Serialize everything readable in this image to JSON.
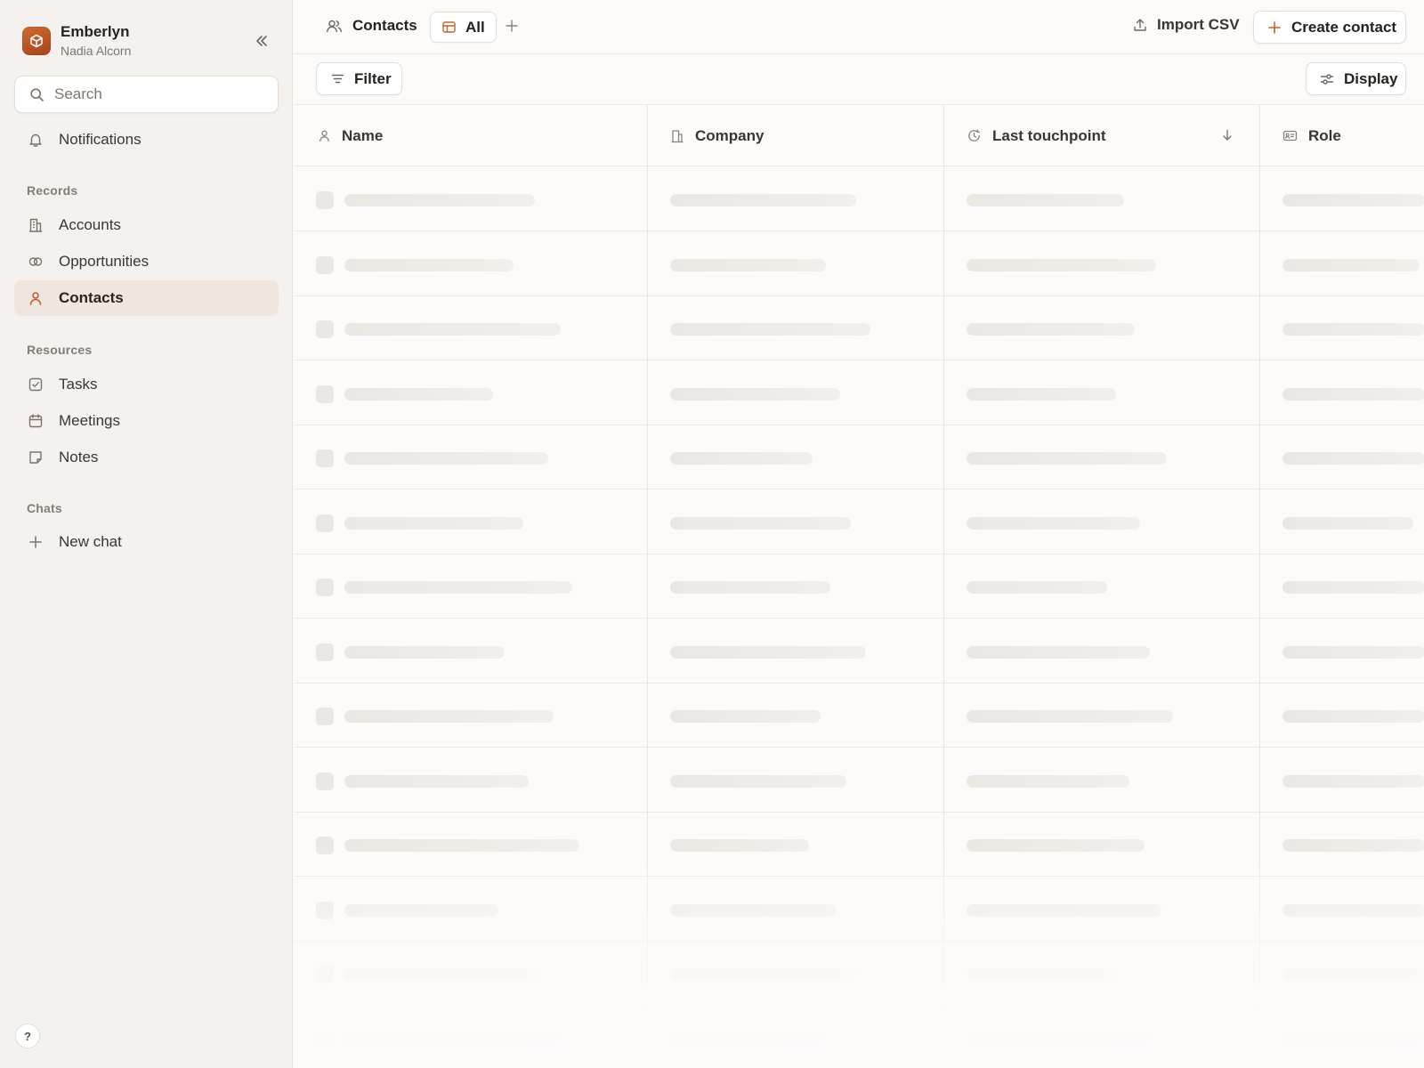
{
  "workspace": {
    "name": "Emberlyn",
    "user": "Nadia Alcorn"
  },
  "sidebar": {
    "search_placeholder": "Search",
    "notifications_label": "Notifications",
    "sections": {
      "records": "Records",
      "resources": "Resources",
      "chats": "Chats"
    },
    "records": [
      {
        "label": "Accounts",
        "icon": "building-icon"
      },
      {
        "label": "Opportunities",
        "icon": "opportunities-icon"
      },
      {
        "label": "Contacts",
        "icon": "person-icon",
        "active": true
      }
    ],
    "resources": [
      {
        "label": "Tasks",
        "icon": "checkbox-icon"
      },
      {
        "label": "Meetings",
        "icon": "calendar-icon"
      },
      {
        "label": "Notes",
        "icon": "note-icon"
      }
    ],
    "chats": [
      {
        "label": "New chat",
        "icon": "plus-icon"
      }
    ],
    "help_label": "?"
  },
  "header": {
    "breadcrumb": "Contacts",
    "view_tab": "All",
    "import_label": "Import CSV",
    "create_label": "Create contact"
  },
  "toolbar": {
    "filter_label": "Filter",
    "display_label": "Display"
  },
  "table": {
    "columns": [
      {
        "label": "Name",
        "icon": "person-icon"
      },
      {
        "label": "Company",
        "icon": "building-icon"
      },
      {
        "label": "Last touchpoint",
        "icon": "clock-icon",
        "sorted": "descending"
      },
      {
        "label": "Role",
        "icon": "id-card-icon"
      }
    ],
    "loading": true
  },
  "colors": {
    "accent": "#c4622c",
    "sidebar_bg": "#f4f1ee",
    "active_bg": "#efe6df",
    "skeleton": "#ebe7e2"
  }
}
